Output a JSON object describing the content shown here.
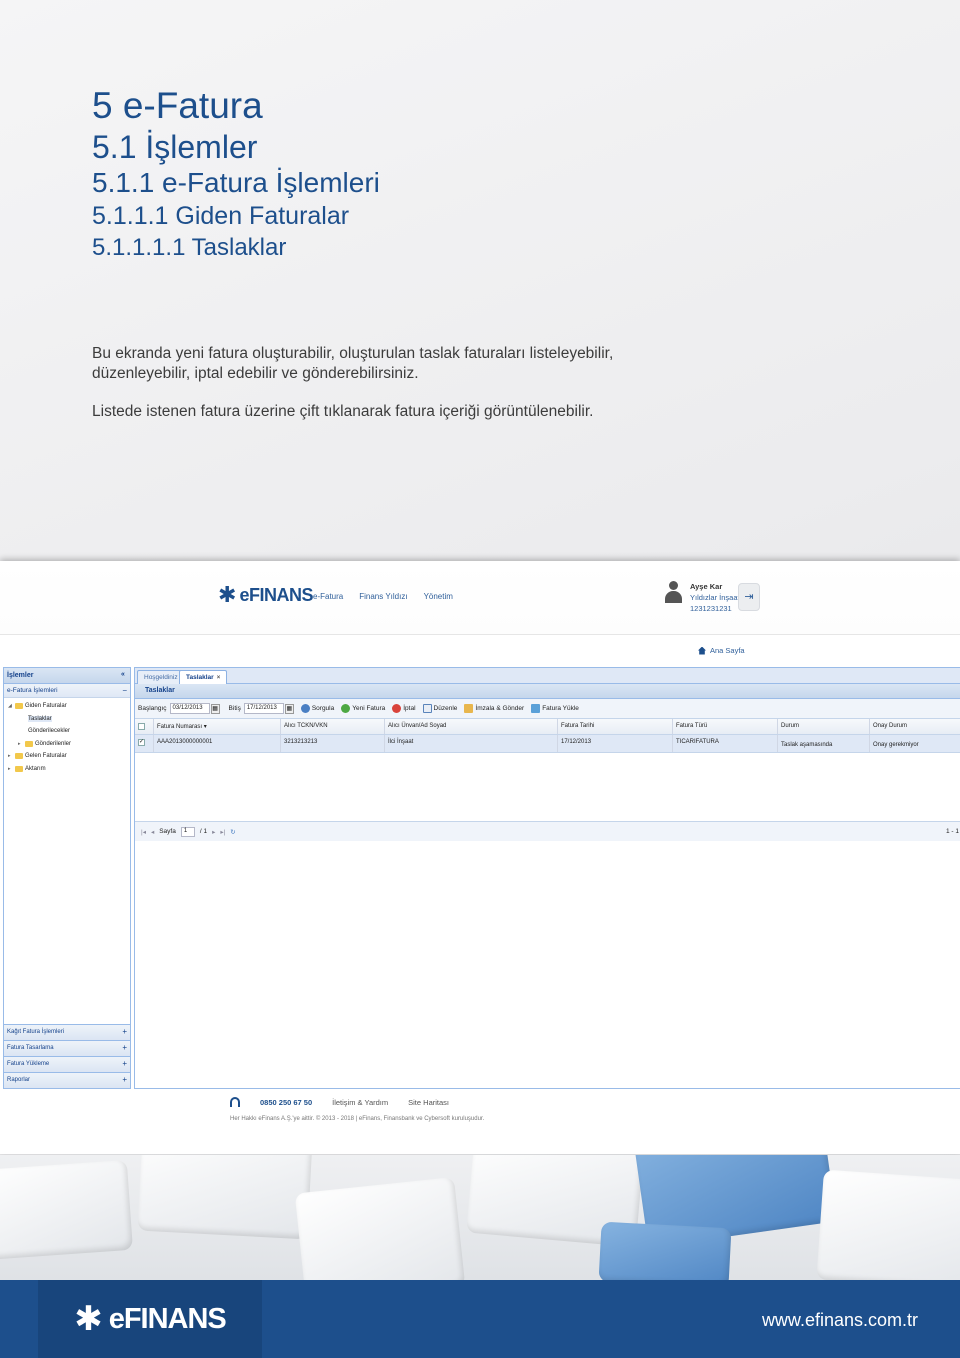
{
  "headings": {
    "h1": "5 e-Fatura",
    "h2": "5.1 İşlemler",
    "h3": "5.1.1 e-Fatura İşlemleri",
    "h4": "5.1.1.1 Giden Faturalar",
    "h5": "5.1.1.1.1 Taslaklar"
  },
  "body": {
    "p1": "Bu ekranda yeni fatura oluşturabilir, oluşturulan taslak faturaları listeleyebilir, düzenleyebilir, iptal edebilir ve gönderebilirsiniz.",
    "p2": "Listede istenen fatura üzerine çift tıklanarak fatura içeriği görüntülenebilir."
  },
  "app": {
    "logo": "eFINANS",
    "nav": [
      "e-Fatura",
      "Finans Yıldızı",
      "Yönetim"
    ],
    "user": {
      "name": "Ayşe Kar",
      "company": "Yıldızlar İnşaat",
      "id": "1231231231"
    },
    "home_link": "Ana Sayfa",
    "left_panel": {
      "title": "İşlemler",
      "section": "e-Fatura İşlemleri",
      "tree": {
        "giden": "Giden Faturalar",
        "taslaklar": "Taslaklar",
        "gonderilecekler": "Gönderilecekler",
        "gonderilenler": "Gönderilenler",
        "gelen": "Gelen Faturalar",
        "aktarim": "Aktarım"
      },
      "bottom": [
        "Kağıt Fatura İşlemleri",
        "Fatura Tasarlama",
        "Fatura Yükleme",
        "Raporlar"
      ]
    },
    "tabs": [
      "Hoşgeldiniz",
      "Taslaklar"
    ],
    "content_title": "Taslaklar",
    "toolbar": {
      "start_label": "Başlangıç",
      "start_value": "03/12/2013",
      "end_label": "Bitiş",
      "end_value": "17/12/2013",
      "buttons": [
        "Sorgula",
        "Yeni Fatura",
        "İptal",
        "Düzenle",
        "İmzala & Gönder",
        "Fatura Yükle"
      ]
    },
    "grid": {
      "columns": [
        "Fatura Numarası",
        "Alıcı TCKN/VKN",
        "Alıcı Ünvan/Ad Soyad",
        "Fatura Tarihi",
        "Fatura Türü",
        "Durum",
        "Onay Durum"
      ],
      "rows": [
        [
          "AAA2013000000001",
          "3213213213",
          "İlci İnşaat",
          "17/12/2013",
          "TICARIFATURA",
          "Taslak aşamasında",
          "Onay gerekmiyor"
        ]
      ]
    },
    "pager": {
      "page_label": "Sayfa",
      "page_value": "1",
      "of": "/ 1",
      "info": "1 - 1"
    },
    "footer": {
      "phone": "0850 250 67 50",
      "links": [
        "İletişim & Yardım",
        "Site Haritası"
      ],
      "copyright": "Her Hakkı eFinans A.Ş.'ye aittir. © 2013 - 2018   |   eFinans, Finansbank ve Cybersoft kuruluşudur."
    }
  },
  "bottom_bar": {
    "logo": "eFINANS",
    "website": "www.efinans.com.tr"
  },
  "colors": {
    "brand_blue": "#1d4f8c",
    "ext_blue": "#99bbe8"
  }
}
